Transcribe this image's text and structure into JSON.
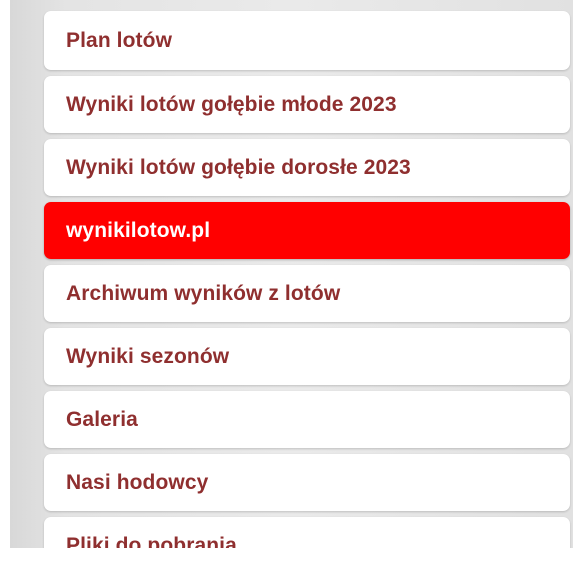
{
  "menu": {
    "items": [
      {
        "label": "Plan lotów"
      },
      {
        "label": "Wyniki lotów gołębie młode 2023"
      },
      {
        "label": "Wyniki lotów gołębie dorosłe 2023"
      },
      {
        "label": "wynikilotow.pl",
        "active": true
      },
      {
        "label": "Archiwum wyników z lotów"
      },
      {
        "label": "Wyniki sezonów"
      },
      {
        "label": "Galeria"
      },
      {
        "label": "Nasi hodowcy"
      },
      {
        "label": "Pliki do pobrania"
      }
    ]
  },
  "colors": {
    "accent": "#ff0000",
    "label_text": "#8f2f2f",
    "active_text": "#ffffff"
  }
}
